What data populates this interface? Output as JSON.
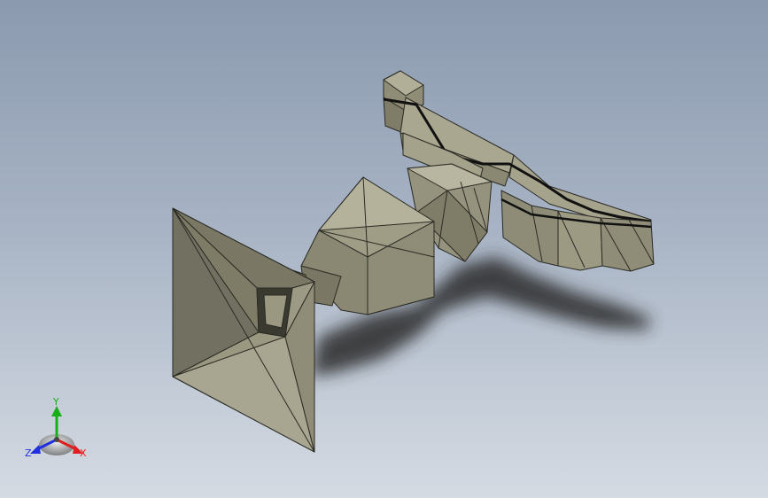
{
  "viewport": {
    "background_top": "#8b9aaf",
    "background_bottom": "#d5dbe3"
  },
  "model": {
    "face_color": "#9a9880",
    "edge_color": "#2b2b25"
  },
  "triad": {
    "x_label": "X",
    "y_label": "Y",
    "z_label": "Z",
    "x_color": "#e02020",
    "y_color": "#18b018",
    "z_color": "#2030e0"
  }
}
